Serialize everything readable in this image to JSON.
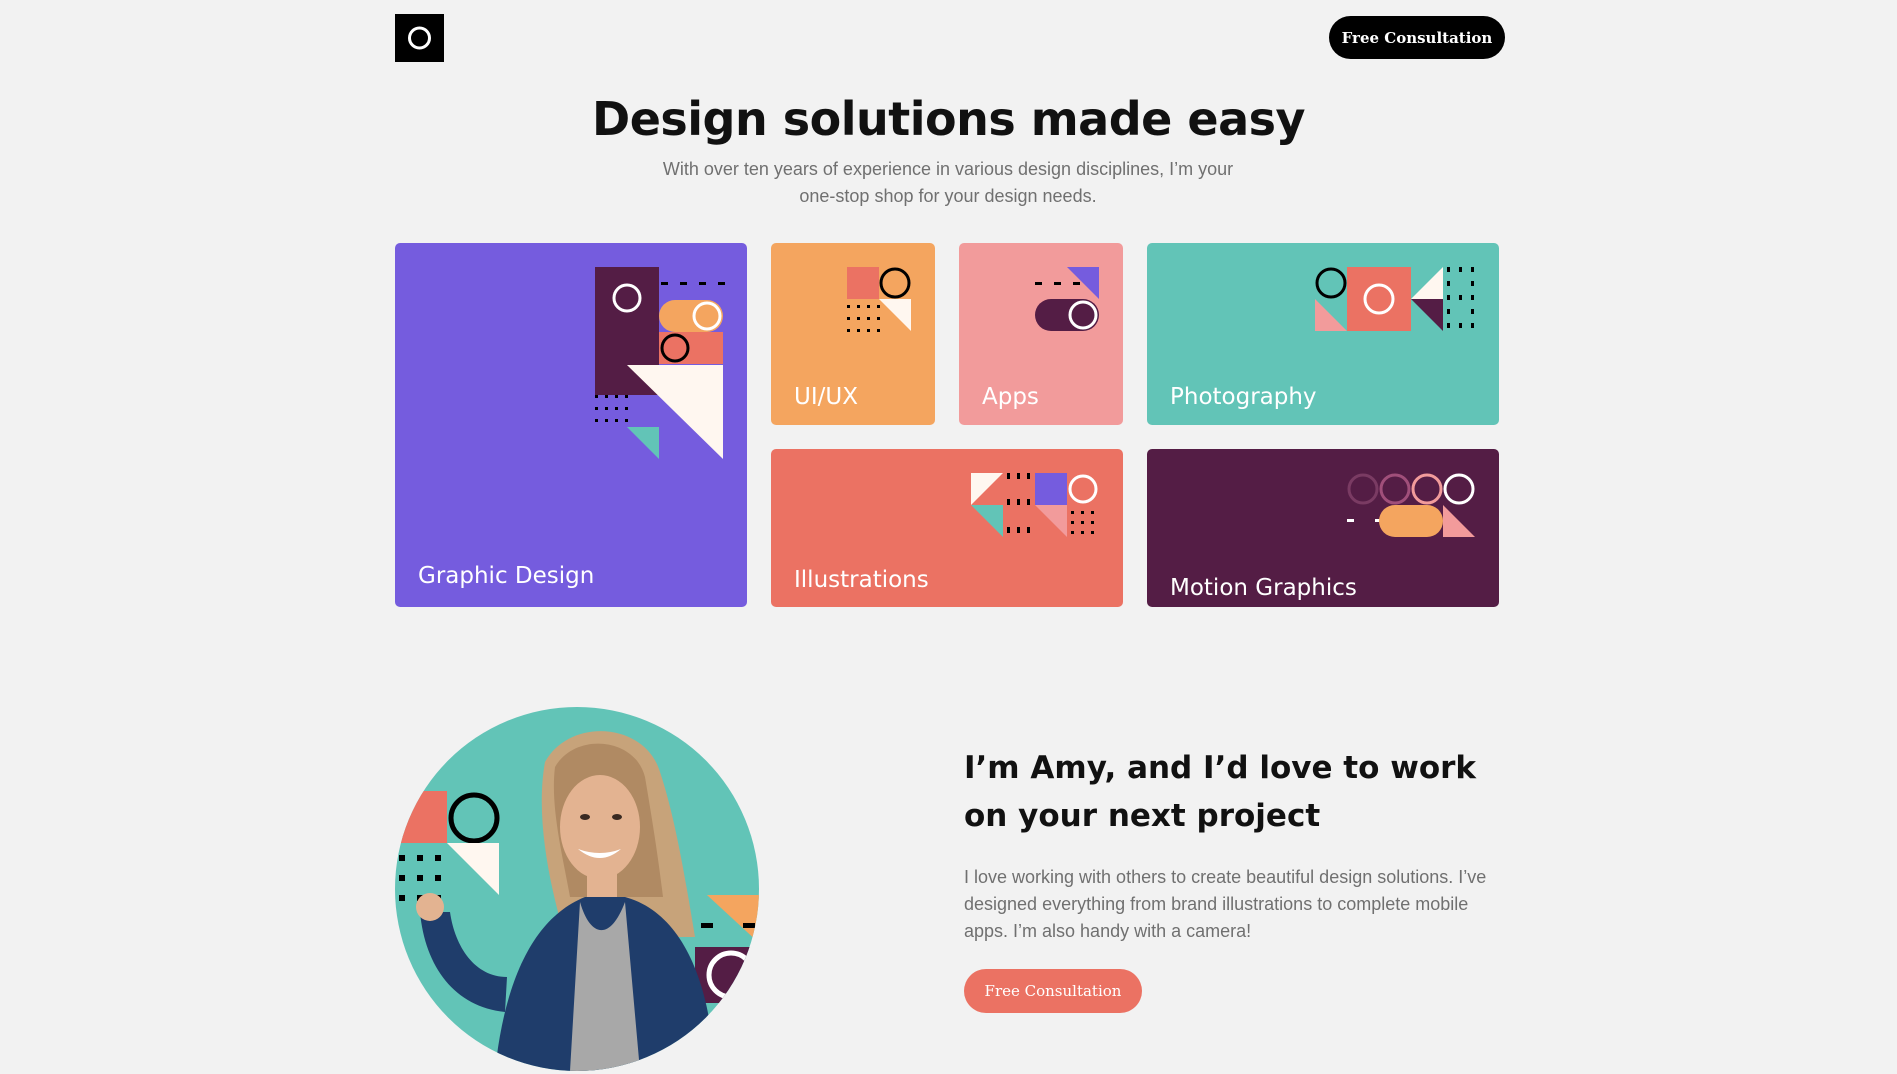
{
  "header": {
    "logo_icon": "ring-logo-icon",
    "cta_label": "Free Consultation"
  },
  "hero": {
    "title": "Design solutions made easy",
    "subtitle": "With over ten years of experience in various design disciplines, I’m your one-stop shop for your design needs."
  },
  "services": [
    {
      "label": "Graphic Design",
      "color": "#755cde"
    },
    {
      "label": "UI/UX",
      "color": "#f4a55f"
    },
    {
      "label": "Apps",
      "color": "#f29b9b"
    },
    {
      "label": "Photography",
      "color": "#62c4b7"
    },
    {
      "label": "Illustrations",
      "color": "#eb7263"
    },
    {
      "label": "Motion Graphics",
      "color": "#541d45"
    }
  ],
  "about": {
    "title": "I’m Amy, and I’d love to work on your next project",
    "text": "I love working with others to create beautiful design solutions. I’ve designed everything from brand illustrations to complete mobile apps. I’m also handy with a camera!",
    "cta_label": "Free Consultation"
  },
  "colors": {
    "background": "#f2f2f2",
    "purple": "#755cde",
    "orange": "#f4a55f",
    "pink": "#f29b9b",
    "teal": "#62c4b7",
    "coral": "#eb7263",
    "plum": "#541d45",
    "cream": "#fff7f0"
  }
}
